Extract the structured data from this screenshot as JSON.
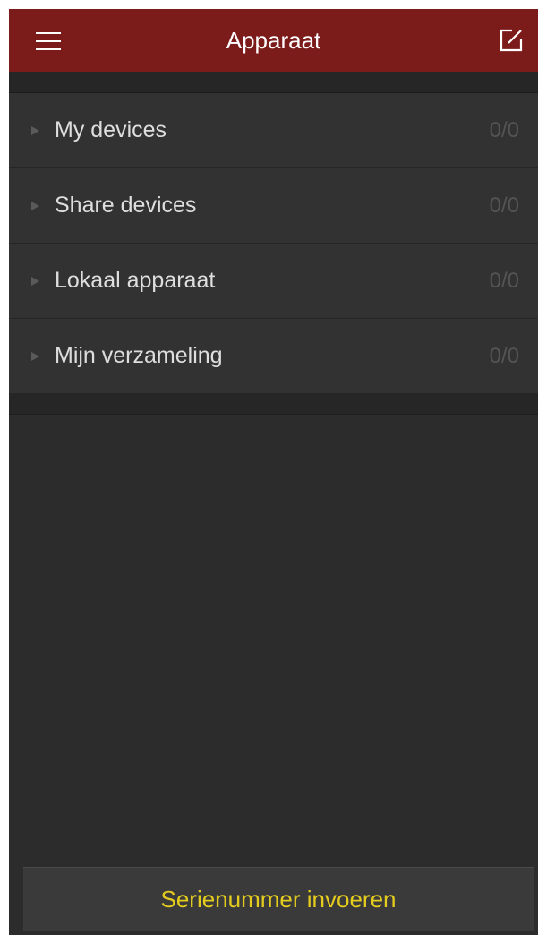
{
  "header": {
    "title": "Apparaat",
    "menu_icon": "hamburger-menu-icon",
    "edit_icon": "edit-icon",
    "background_color": "#7b1c1b"
  },
  "device_groups": [
    {
      "label": "My devices",
      "count": "0/0"
    },
    {
      "label": "Share devices",
      "count": "0/0"
    },
    {
      "label": "Lokaal apparaat",
      "count": "0/0"
    },
    {
      "label": "Mijn verzameling",
      "count": "0/0"
    }
  ],
  "footer": {
    "serial_button_label": "Serienummer invoeren",
    "serial_button_text_color": "#e4cc1e"
  }
}
